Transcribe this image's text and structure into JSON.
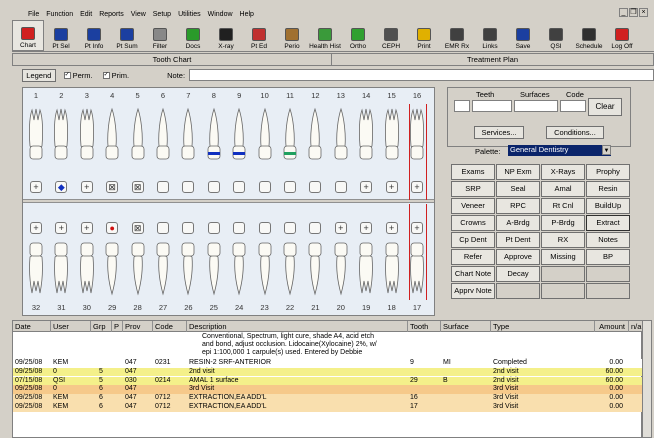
{
  "menu": [
    "File",
    "Function",
    "Edit",
    "Reports",
    "View",
    "Setup",
    "Utilities",
    "Window",
    "Help"
  ],
  "window_controls": [
    "_",
    "❐",
    "×"
  ],
  "toolbar": [
    {
      "label": "Chart",
      "icon": "tooth-icon",
      "color": "#d02020"
    },
    {
      "label": "Pt Sel",
      "icon": "patient-select-icon",
      "color": "#1b3fa0"
    },
    {
      "label": "Pt Info",
      "icon": "patient-info-icon",
      "color": "#1b3fa0"
    },
    {
      "label": "Pt Sum",
      "icon": "patient-summary-icon",
      "color": "#1b3fa0"
    },
    {
      "label": "Filter",
      "icon": "filter-icon",
      "color": "#888888"
    },
    {
      "label": "Docs",
      "icon": "docs-icon",
      "color": "#2a9a2a"
    },
    {
      "label": "X-ray",
      "icon": "xray-icon",
      "color": "#202020"
    },
    {
      "label": "Pt Ed",
      "icon": "patient-education-icon",
      "color": "#c03030"
    },
    {
      "label": "Perio",
      "icon": "perio-icon",
      "color": "#a07030"
    },
    {
      "label": "Health Hist",
      "icon": "health-history-icon",
      "color": "#3a9a3a"
    },
    {
      "label": "Ortho",
      "icon": "ortho-icon",
      "color": "#30a030"
    },
    {
      "label": "CEPH",
      "icon": "ceph-icon",
      "color": "#505050"
    },
    {
      "label": "Print",
      "icon": "print-icon",
      "color": "#e0b000"
    },
    {
      "label": "EMR Rx",
      "icon": "rx-icon",
      "color": "#404040"
    },
    {
      "label": "Links",
      "icon": "links-icon",
      "color": "#404040"
    },
    {
      "label": "Save",
      "icon": "save-icon",
      "color": "#1b3fa0"
    },
    {
      "label": "QSI",
      "icon": "qsi-icon",
      "color": "#404040"
    },
    {
      "label": "Schedule",
      "icon": "schedule-icon",
      "color": "#303030"
    },
    {
      "label": "Log Off",
      "icon": "log-off-icon",
      "color": "#d02020"
    }
  ],
  "tabs": {
    "tooth_chart": "Tooth Chart",
    "treatment_plan": "Treatment Plan"
  },
  "legend_bar": {
    "legend_button": "Legend",
    "perm_label": "Perm.",
    "prim_label": "Prim.",
    "note_label": "Note:",
    "note_value": "",
    "perm_checked": true,
    "prim_checked": true
  },
  "upper_numbers": [
    "1",
    "2",
    "3",
    "4",
    "5",
    "6",
    "7",
    "8",
    "9",
    "10",
    "11",
    "12",
    "13",
    "14",
    "15",
    "16"
  ],
  "lower_numbers": [
    "32",
    "31",
    "30",
    "29",
    "28",
    "27",
    "26",
    "25",
    "24",
    "23",
    "22",
    "21",
    "20",
    "19",
    "18",
    "17"
  ],
  "upper_restorations": [
    "+",
    "◆",
    "+",
    "⊠",
    "⊠",
    "",
    "",
    "",
    "",
    "",
    "",
    "",
    "",
    "+",
    "+",
    "+"
  ],
  "lower_restorations": [
    "+",
    "+",
    "+",
    "●",
    "⊠",
    "",
    "",
    "",
    "",
    "",
    "",
    "",
    "+",
    "+",
    "+",
    "+"
  ],
  "right_panel": {
    "teeth_label": "Teeth",
    "surfaces_label": "Surfaces",
    "code_label": "Code",
    "clear_button": "Clear",
    "services_button": "Services...",
    "conditions_button": "Conditions...",
    "palette_label": "Palette:",
    "palette_value": "General Dentistry"
  },
  "procedures": [
    "Exams",
    "NP Exm",
    "X-Rays",
    "Prophy",
    "SRP",
    "Seal",
    "Amal",
    "Resin",
    "Veneer",
    "RPC",
    "Rt Cnl",
    "BuildUp",
    "Crowns",
    "A-Brdg",
    "P-Brdg",
    "Extract",
    "Cp Dent",
    "Pt Dent",
    "RX",
    "Notes",
    "Refer",
    "Approve",
    "Missing",
    "BP",
    "Chart Note",
    "Decay",
    "",
    "",
    "Apprv Note",
    "",
    "",
    ""
  ],
  "grid": {
    "headers": [
      "Date",
      "User",
      "Grp",
      "P",
      "Prov",
      "Code",
      "Description",
      "Tooth",
      "Surface",
      "Type",
      "Amount",
      "n/a"
    ],
    "continued_description": [
      "Conventional, Spectrum, light cure, shade A4, acid etch",
      "and bond, adjust occlusion.  Lidocaine(Xylocaine) 2%, w/",
      "epi 1:100,000  1 carpule(s) used. Entered by Debbie"
    ],
    "rows": [
      {
        "date": "09/25/08",
        "user": "KEM",
        "grp": "",
        "p": "",
        "prov": "047",
        "code": "0231",
        "desc": "RESIN-2 SRF-ANTERIOR",
        "tooth": "9",
        "surface": "MI",
        "type": "Completed",
        "amount": "0.00",
        "bg": "#ffffff"
      },
      {
        "date": "09/25/08",
        "user": "0",
        "grp": "5",
        "p": "",
        "prov": "047",
        "code": "",
        "desc": "2nd visit",
        "tooth": "",
        "surface": "",
        "type": "2nd visit",
        "amount": "60.00",
        "bg": "#f4f08a"
      },
      {
        "date": "07/15/08",
        "user": "QSI",
        "grp": "5",
        "p": "",
        "prov": "030",
        "code": "0214",
        "desc": "AMAL 1 surface",
        "tooth": "29",
        "surface": "B",
        "type": "2nd visit",
        "amount": "60.00",
        "bg": "#f4f08a"
      },
      {
        "date": "09/25/08",
        "user": "0",
        "grp": "6",
        "p": "",
        "prov": "047",
        "code": "",
        "desc": "3rd Visit",
        "tooth": "",
        "surface": "",
        "type": "3rd Visit",
        "amount": "0.00",
        "bg": "#f6c98a"
      },
      {
        "date": "09/25/08",
        "user": "KEM",
        "grp": "6",
        "p": "",
        "prov": "047",
        "code": "0712",
        "desc": "EXTRACTION,EA ADD'L",
        "tooth": "16",
        "surface": "",
        "type": "3rd Visit",
        "amount": "0.00",
        "bg": "#f9dfae"
      },
      {
        "date": "09/25/08",
        "user": "KEM",
        "grp": "6",
        "p": "",
        "prov": "047",
        "code": "0712",
        "desc": "EXTRACTION,EA ADD'L",
        "tooth": "17",
        "surface": "",
        "type": "3rd Visit",
        "amount": "0.00",
        "bg": "#f9dfae"
      }
    ]
  }
}
